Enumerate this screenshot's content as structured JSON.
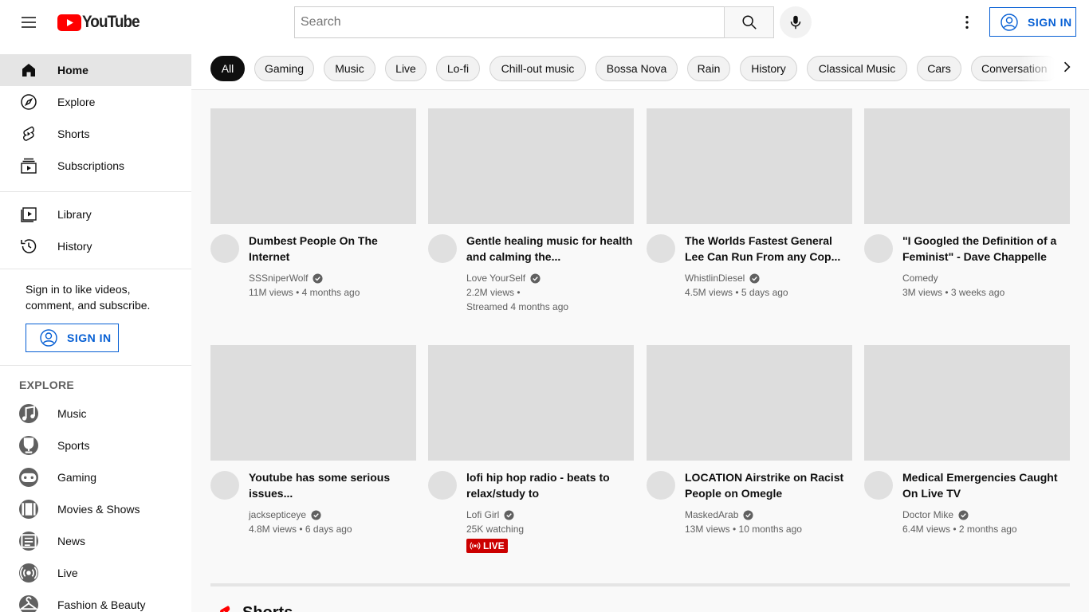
{
  "header": {
    "logo_text": "YouTube",
    "search_placeholder": "Search",
    "signin_label": "SIGN IN"
  },
  "sidebar": {
    "main_items": [
      {
        "label": "Home",
        "icon": "home-icon",
        "active": true
      },
      {
        "label": "Explore",
        "icon": "compass-icon"
      },
      {
        "label": "Shorts",
        "icon": "shorts-icon"
      },
      {
        "label": "Subscriptions",
        "icon": "subscriptions-icon"
      }
    ],
    "library_items": [
      {
        "label": "Library",
        "icon": "library-icon"
      },
      {
        "label": "History",
        "icon": "history-icon"
      }
    ],
    "signin_note": "Sign in to like videos, comment, and subscribe.",
    "signin_label": "SIGN IN",
    "explore_title": "EXPLORE",
    "explore_items": [
      {
        "label": "Music",
        "icon": "music-icon"
      },
      {
        "label": "Sports",
        "icon": "trophy-icon"
      },
      {
        "label": "Gaming",
        "icon": "gamepad-icon"
      },
      {
        "label": "Movies & Shows",
        "icon": "film-icon"
      },
      {
        "label": "News",
        "icon": "news-icon"
      },
      {
        "label": "Live",
        "icon": "live-icon"
      },
      {
        "label": "Fashion & Beauty",
        "icon": "hanger-icon"
      }
    ]
  },
  "chips": [
    "All",
    "Gaming",
    "Music",
    "Live",
    "Lo-fi",
    "Chill-out music",
    "Bossa Nova",
    "Rain",
    "History",
    "Classical Music",
    "Cars",
    "Conversation"
  ],
  "videos": [
    {
      "title": "Dumbest People On The Internet",
      "channel": "SSSniperWolf",
      "meta": "11M views • 4 months ago"
    },
    {
      "title": "Gentle healing music for health and calming the...",
      "channel": "Love YourSelf",
      "meta": "2.2M views •",
      "meta2": "Streamed 4 months ago"
    },
    {
      "title": "The Worlds Fastest General Lee Can Run From any Cop...",
      "channel": "WhistlinDiesel",
      "meta": "4.5M views • 5 days ago"
    },
    {
      "title": "\"I Googled the Definition of a Feminist\" - Dave Chappelle",
      "channel": "Comedy",
      "meta": "3M views • 3 weeks ago"
    },
    {
      "title": "Youtube has some serious issues...",
      "channel": "jacksepticeye",
      "meta": "4.8M views • 6 days ago"
    },
    {
      "title": "lofi hip hop radio - beats to relax/study to",
      "channel": "Lofi Girl",
      "meta": "25K watching",
      "badge": "LIVE"
    },
    {
      "title": "LOCATION Airstrike on Racist People on Omegle",
      "channel": "MaskedArab",
      "meta": "13M views • 10 months ago"
    },
    {
      "title": "Medical Emergencies Caught On Live TV",
      "channel": "Doctor Mike",
      "meta": "6.4M views • 2 months ago"
    }
  ],
  "shorts_title": "Shorts",
  "colors": {
    "brand_red": "#ff0000",
    "link_blue": "#065fd4",
    "live_red": "#cc0000"
  }
}
